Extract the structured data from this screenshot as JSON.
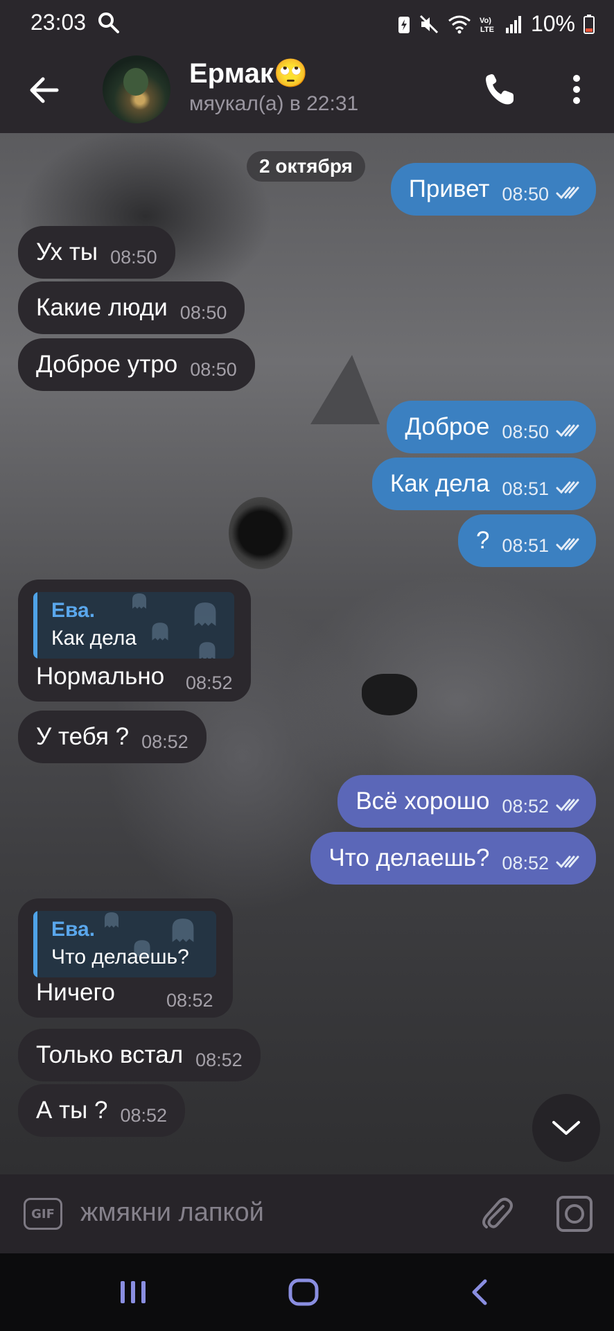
{
  "status_bar": {
    "time": "23:03",
    "battery": "10%",
    "volte": "Vo)\nLTE"
  },
  "header": {
    "contact_name": "Ермак",
    "emoji": "🙄",
    "status": "мяукал(а) в 22:31"
  },
  "chat": {
    "date": "2 октября",
    "messages": [
      {
        "dir": "out",
        "text": "Привет",
        "time": "08:50"
      },
      {
        "dir": "in",
        "text": "Ух ты",
        "time": "08:50"
      },
      {
        "dir": "in",
        "text": "Какие люди",
        "time": "08:50"
      },
      {
        "dir": "in",
        "text": "Доброе утро",
        "time": "08:50"
      },
      {
        "dir": "out",
        "text": "Доброе",
        "time": "08:50"
      },
      {
        "dir": "out",
        "text": "Как дела",
        "time": "08:51"
      },
      {
        "dir": "out",
        "text": "?",
        "time": "08:51"
      },
      {
        "dir": "in",
        "reply_name": "Ева.",
        "reply_text": "Как дела",
        "text": "Нормально",
        "time": "08:52"
      },
      {
        "dir": "in",
        "text": "У тебя ?",
        "time": "08:52"
      },
      {
        "dir": "out",
        "text": "Всё хорошо",
        "time": "08:52"
      },
      {
        "dir": "out",
        "text": "Что делаешь?",
        "time": "08:52"
      },
      {
        "dir": "in",
        "reply_name": "Ева.",
        "reply_text": "Что делаешь?",
        "text": "Ничего",
        "time": "08:52"
      },
      {
        "dir": "in",
        "text": "Только встал",
        "time": "08:52"
      },
      {
        "dir": "in",
        "text": "А ты ?",
        "time": "08:52"
      }
    ]
  },
  "input": {
    "placeholder": "жмякни лапкой",
    "gif_label": "GIF"
  },
  "colors": {
    "outgoing_blue": "#3b80c1",
    "outgoing_purple": "#5b67b8",
    "incoming": "#2b282d",
    "reply_accent": "#5aa7ec"
  },
  "icons": [
    "search-icon",
    "back-arrow-icon",
    "phone-icon",
    "more-vertical-icon",
    "double-check-icon",
    "ghost-icon",
    "chevron-down-icon",
    "paperclip-icon",
    "camera-icon",
    "nav-recents-icon",
    "nav-home-icon",
    "nav-back-icon"
  ]
}
